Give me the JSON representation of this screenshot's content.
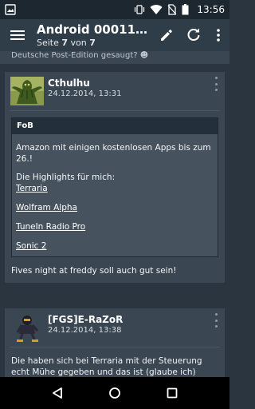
{
  "status_bar": {
    "time": "13:56",
    "icons": [
      "notification-image-icon",
      "vibrate-icon",
      "wifi-icon",
      "no-sim-icon",
      "battery-icon"
    ]
  },
  "app_bar": {
    "title": "Android 000110...",
    "subtitle_prefix": "Seite ",
    "page_current": "7",
    "subtitle_mid": " von ",
    "page_total": "7",
    "actions": [
      "edit-icon",
      "refresh-icon",
      "overflow-menu-icon"
    ]
  },
  "thread": {
    "previous_snippet": "Deutsche Post-Edition gesaugt?",
    "posts": [
      {
        "author": "Cthulhu",
        "date": "24.12.2014, 13:31",
        "quote": {
          "title": "FoB",
          "text": "Amazon mit einigen kostenlosen Apps bis zum 26.!",
          "intro": "Die Highlights für mich:",
          "links": [
            "Terraria",
            "Wolfram Alpha",
            "TuneIn Radio Pro",
            "Sonic 2"
          ]
        },
        "text": "Fives night at freddy soll auch gut sein!"
      },
      {
        "author": "[FGS]E-RaZoR",
        "date": "24.12.2014, 13:38",
        "text": "Die haben sich bei Terraria mit der Steuerung echt Mühe gegeben und das ist (glaube ich) recht"
      }
    ]
  },
  "colors": {
    "status_bar": "#1c2730",
    "app_bar": "#2f3d49",
    "background": "#2b3540",
    "card": "#3a4651",
    "quote_header": "#243039"
  }
}
